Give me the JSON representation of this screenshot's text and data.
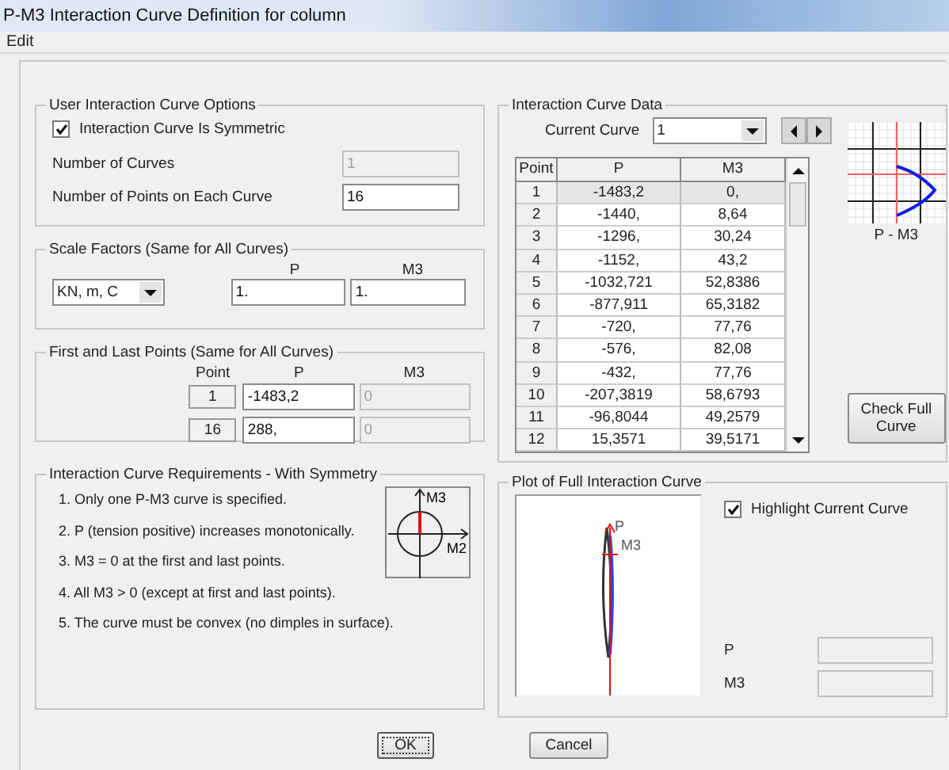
{
  "window": {
    "title": "P-M3 Interaction Curve Definition for column"
  },
  "menu": [
    "Edit"
  ],
  "options": {
    "title": "User Interaction Curve Options",
    "symmetric": {
      "label": "Interaction Curve Is Symmetric",
      "checked": true
    },
    "fields": [
      {
        "label": "Number of Curves",
        "value": "1",
        "disabled": true
      },
      {
        "label": "Number of Points on Each Curve",
        "value": "16",
        "disabled": false
      }
    ]
  },
  "scale": {
    "title": "Scale Factors (Same for All Curves)",
    "units": "KN, m, C",
    "columns": [
      "P",
      "M3"
    ],
    "values": [
      "1.",
      "1."
    ]
  },
  "endpoints": {
    "title": "First and Last Points (Same for All Curves)",
    "columns": [
      "Point",
      "P",
      "M3"
    ],
    "rows": [
      {
        "point": "1",
        "p": "-1483,2",
        "m3": "0"
      },
      {
        "point": "16",
        "p": "288,",
        "m3": "0"
      }
    ]
  },
  "requirements": {
    "title": "Interaction Curve Requirements - With Symmetry",
    "items": [
      "1.  Only one P-M3 curve is specified.",
      "2.  P (tension positive) increases monotonically.",
      "3.  M3 = 0 at the first and last points.",
      "4.  All M3 > 0 (except at first and last points).",
      "5.  The curve must be convex (no dimples in surface)."
    ],
    "diagram_labels": [
      "M3",
      "M2"
    ]
  },
  "curve_data": {
    "title": "Interaction Curve Data",
    "current_curve_label": "Current Curve",
    "current_curve": "1",
    "columns": [
      "Point",
      "P",
      "M3"
    ],
    "rows": [
      {
        "point": "1",
        "p": "-1483,2",
        "m3": "0,",
        "selected": true
      },
      {
        "point": "2",
        "p": "-1440,",
        "m3": "8,64",
        "selected": false
      },
      {
        "point": "3",
        "p": "-1296,",
        "m3": "30,24",
        "selected": false
      },
      {
        "point": "4",
        "p": "-1152,",
        "m3": "43,2",
        "selected": false
      },
      {
        "point": "5",
        "p": "-1032,721",
        "m3": "52,8386",
        "selected": false
      },
      {
        "point": "6",
        "p": "-877,911",
        "m3": "65,3182",
        "selected": false
      },
      {
        "point": "7",
        "p": "-720,",
        "m3": "77,76",
        "selected": false
      },
      {
        "point": "8",
        "p": "-576,",
        "m3": "82,08",
        "selected": false
      },
      {
        "point": "9",
        "p": "-432,",
        "m3": "77,76",
        "selected": false
      },
      {
        "point": "10",
        "p": "-207,3819",
        "m3": "58,6793",
        "selected": false
      },
      {
        "point": "11",
        "p": "-96,8044",
        "m3": "49,2579",
        "selected": false
      },
      {
        "point": "12",
        "p": "15,3571",
        "m3": "39,5171",
        "selected": false
      }
    ],
    "preview_caption": "P - M3",
    "check_button": "Check Full Curve"
  },
  "plot": {
    "title": "Plot of Full Interaction Curve",
    "axis_labels": [
      "P",
      "M3"
    ],
    "highlight": {
      "label": "Highlight Current Curve",
      "checked": true
    },
    "readouts": [
      "P",
      "M3"
    ]
  },
  "buttons": [
    "OK",
    "Cancel"
  ]
}
